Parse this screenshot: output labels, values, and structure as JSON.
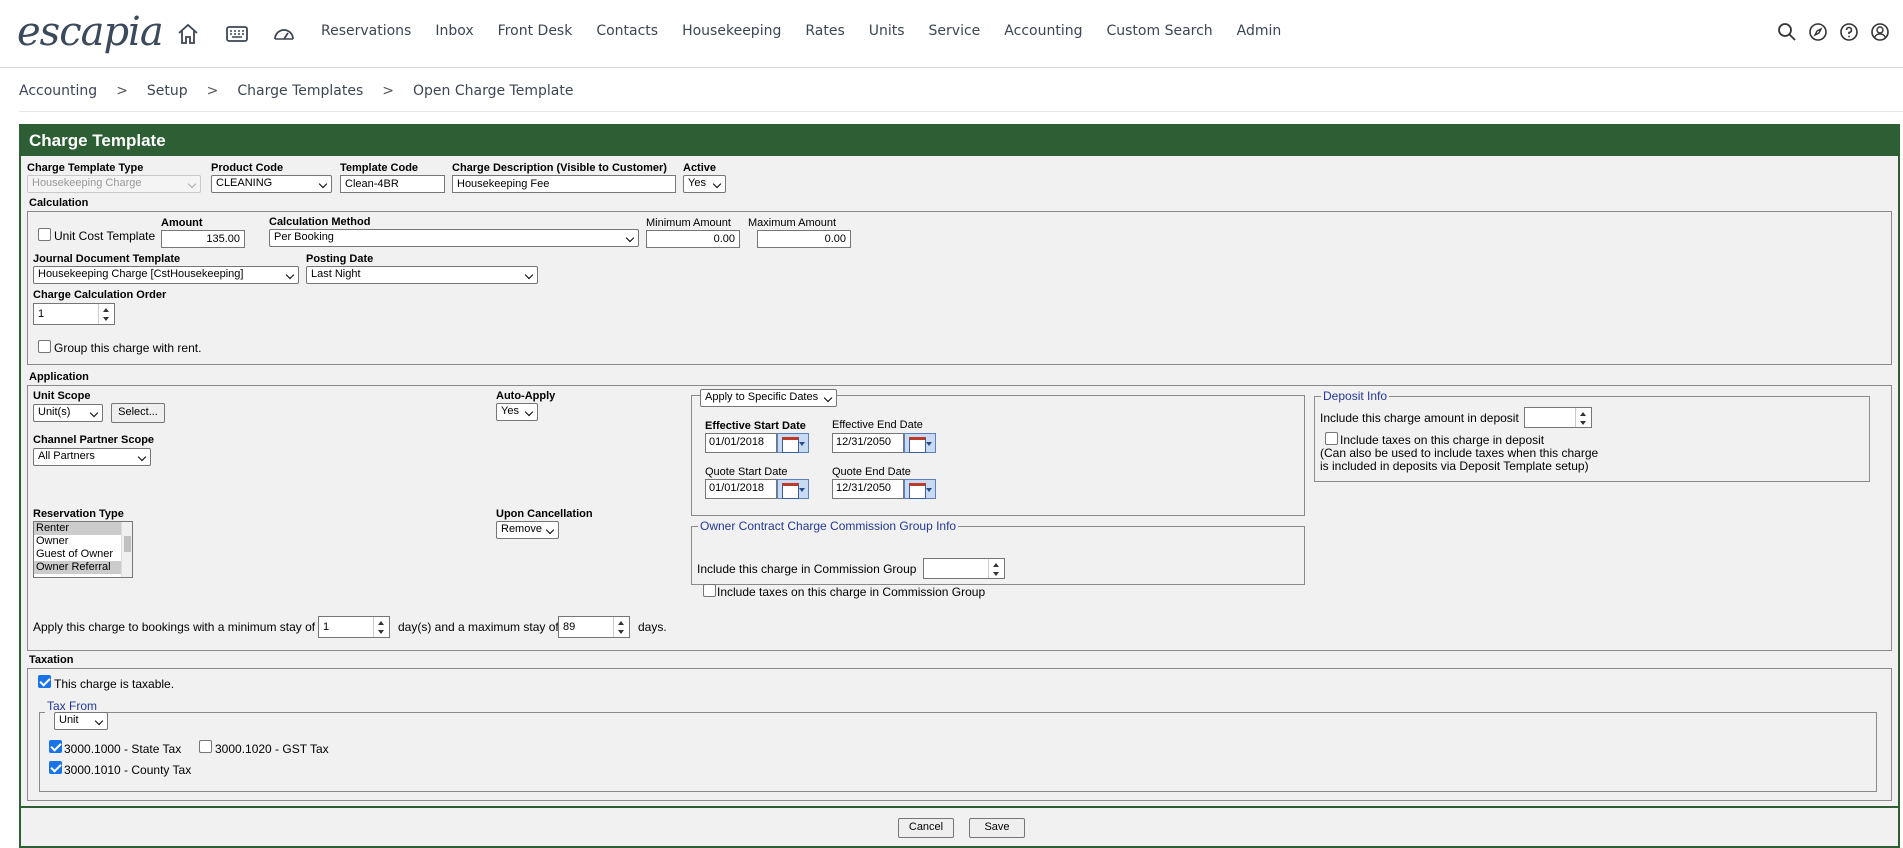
{
  "app": {
    "logo": "escapia"
  },
  "nav": {
    "items": [
      "Reservations",
      "Inbox",
      "Front Desk",
      "Contacts",
      "Housekeeping",
      "Rates",
      "Units",
      "Service",
      "Accounting",
      "Custom Search",
      "Admin"
    ]
  },
  "breadcrumb": [
    "Accounting",
    "Setup",
    "Charge Templates",
    "Open Charge Template"
  ],
  "panel": {
    "title": "Charge Template"
  },
  "header_fields": {
    "type_label": "Charge Template Type",
    "type_value": "Housekeeping Charge",
    "product_label": "Product Code",
    "product_value": "CLEANING",
    "template_code_label": "Template Code",
    "template_code_value": "Clean-4BR",
    "desc_label": "Charge Description (Visible to Customer)",
    "desc_value": "Housekeeping Fee",
    "active_label": "Active",
    "active_value": "Yes"
  },
  "calculation": {
    "section": "Calculation",
    "unit_cost_label": "Unit Cost Template",
    "amount_label": "Amount",
    "amount_value": "135.00",
    "method_label": "Calculation Method",
    "method_value": "Per Booking",
    "min_label": "Minimum Amount",
    "min_value": "0.00",
    "max_label": "Maximum Amount",
    "max_value": "0.00",
    "journal_label": "Journal Document Template",
    "journal_value": "Housekeeping Charge [CstHousekeeping]",
    "posting_label": "Posting Date",
    "posting_value": "Last Night",
    "order_label": "Charge Calculation Order",
    "order_value": "1",
    "group_label": "Group this charge with rent."
  },
  "application": {
    "section": "Application",
    "unit_scope_label": "Unit Scope",
    "unit_scope_value": "Unit(s)",
    "select_button": "Select...",
    "auto_apply_label": "Auto-Apply",
    "auto_apply_value": "Yes",
    "date_mode": "Apply to Specific Dates",
    "eff_start_label": "Effective Start Date",
    "eff_start_value": "01/01/2018",
    "eff_end_label": "Effective End Date",
    "eff_end_value": "12/31/2050",
    "quote_start_label": "Quote Start Date",
    "quote_start_value": "01/01/2018",
    "quote_end_label": "Quote End Date",
    "quote_end_value": "12/31/2050",
    "channel_label": "Channel Partner Scope",
    "channel_value": "All Partners",
    "deposit_legend": "Deposit Info",
    "deposit_include_label": "Include this charge amount in deposit",
    "deposit_taxes_label": "Include taxes on this charge in deposit",
    "deposit_note1": "(Can also be used to include taxes when this charge",
    "deposit_note2": "is included in deposits via Deposit Template setup)",
    "res_type_label": "Reservation Type",
    "res_types": [
      "Renter",
      "Owner",
      "Guest of Owner",
      "Owner Referral"
    ],
    "cancel_label": "Upon Cancellation",
    "cancel_value": "Remove",
    "commission_legend": "Owner Contract Charge Commission Group Info",
    "commission_include_label": "Include this charge in Commission Group",
    "commission_taxes_label": "Include taxes on this charge in Commission Group",
    "stay_prefix": "Apply this charge to bookings with a minimum stay of",
    "stay_min": "1",
    "stay_mid": "day(s) and a maximum stay of",
    "stay_max": "89",
    "stay_suffix": "days."
  },
  "taxation": {
    "section": "Taxation",
    "taxable_label": "This charge is taxable.",
    "tax_from_legend": "Tax From",
    "tax_from_value": "Unit",
    "tax1": "3000.1000 - State Tax",
    "tax2": "3000.1020 - GST Tax",
    "tax3": "3000.1010 - County Tax"
  },
  "footer": {
    "cancel": "Cancel",
    "save": "Save"
  }
}
